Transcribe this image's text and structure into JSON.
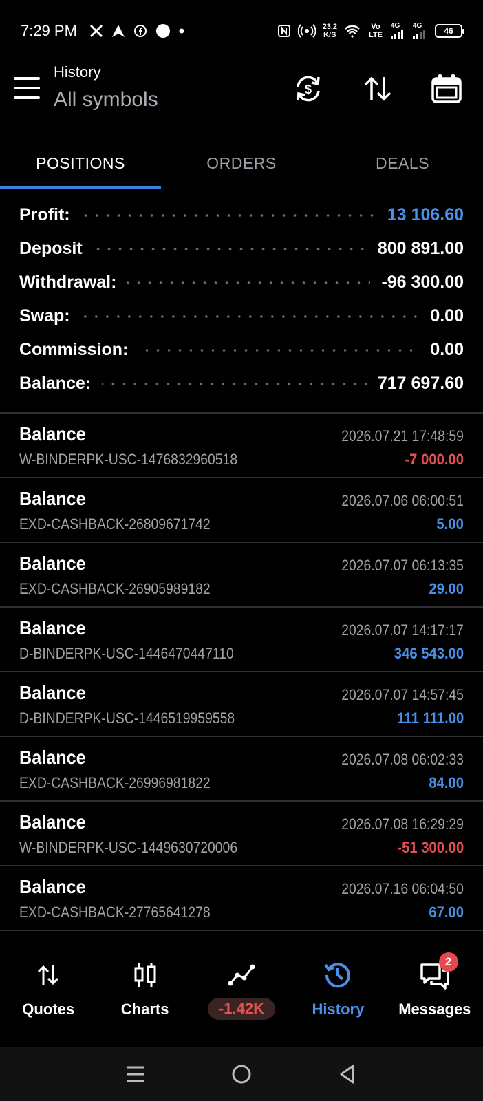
{
  "status_bar": {
    "time": "7:29 PM",
    "speed_value": "23.2",
    "speed_unit": "K/S",
    "network_label": "Vo LTE",
    "signal_1": "4G",
    "signal_2": "4G",
    "battery": "46"
  },
  "header": {
    "title": "History",
    "subtitle": "All symbols"
  },
  "tabs": [
    {
      "label": "POSITIONS",
      "active": true
    },
    {
      "label": "ORDERS",
      "active": false
    },
    {
      "label": "DEALS",
      "active": false
    }
  ],
  "summary": [
    {
      "label": "Profit:",
      "value": "13 106.60"
    },
    {
      "label": "Deposit",
      "value": "800 891.00"
    },
    {
      "label": "Withdrawal:",
      "value": "-96 300.00"
    },
    {
      "label": "Swap:",
      "value": "0.00"
    },
    {
      "label": "Commission:",
      "value": "0.00"
    },
    {
      "label": "Balance:",
      "value": "717 697.60"
    }
  ],
  "deals": [
    {
      "type": "Balance",
      "comment": "W-BINDERPK-USC-1476832960518",
      "time": "2026.07.21 17:48:59",
      "amount": "-7 000.00",
      "sign": "neg"
    },
    {
      "type": "Balance",
      "comment": "EXD-CASHBACK-26809671742",
      "time": "2026.07.06 06:00:51",
      "amount": "5.00",
      "sign": "pos"
    },
    {
      "type": "Balance",
      "comment": "EXD-CASHBACK-26905989182",
      "time": "2026.07.07 06:13:35",
      "amount": "29.00",
      "sign": "pos"
    },
    {
      "type": "Balance",
      "comment": "D-BINDERPK-USC-1446470447110",
      "time": "2026.07.07 14:17:17",
      "amount": "346 543.00",
      "sign": "pos"
    },
    {
      "type": "Balance",
      "comment": "D-BINDERPK-USC-1446519959558",
      "time": "2026.07.07 14:57:45",
      "amount": "111 111.00",
      "sign": "pos"
    },
    {
      "type": "Balance",
      "comment": "EXD-CASHBACK-26996981822",
      "time": "2026.07.08 06:02:33",
      "amount": "84.00",
      "sign": "pos"
    },
    {
      "type": "Balance",
      "comment": "W-BINDERPK-USC-1449630720006",
      "time": "2026.07.08 16:29:29",
      "amount": "-51 300.00",
      "sign": "neg"
    },
    {
      "type": "Balance",
      "comment": "EXD-CASHBACK-27765641278",
      "time": "2026.07.16 06:04:50",
      "amount": "67.00",
      "sign": "pos"
    }
  ],
  "bottom_nav": {
    "quotes": "Quotes",
    "charts": "Charts",
    "trade_pl": "-1.42K",
    "history": "History",
    "messages": "Messages",
    "messages_badge": "2"
  },
  "colors": {
    "accent": "#3c7ee6",
    "positive": "#4a8fe8",
    "negative": "#e65052",
    "background": "#000000"
  }
}
